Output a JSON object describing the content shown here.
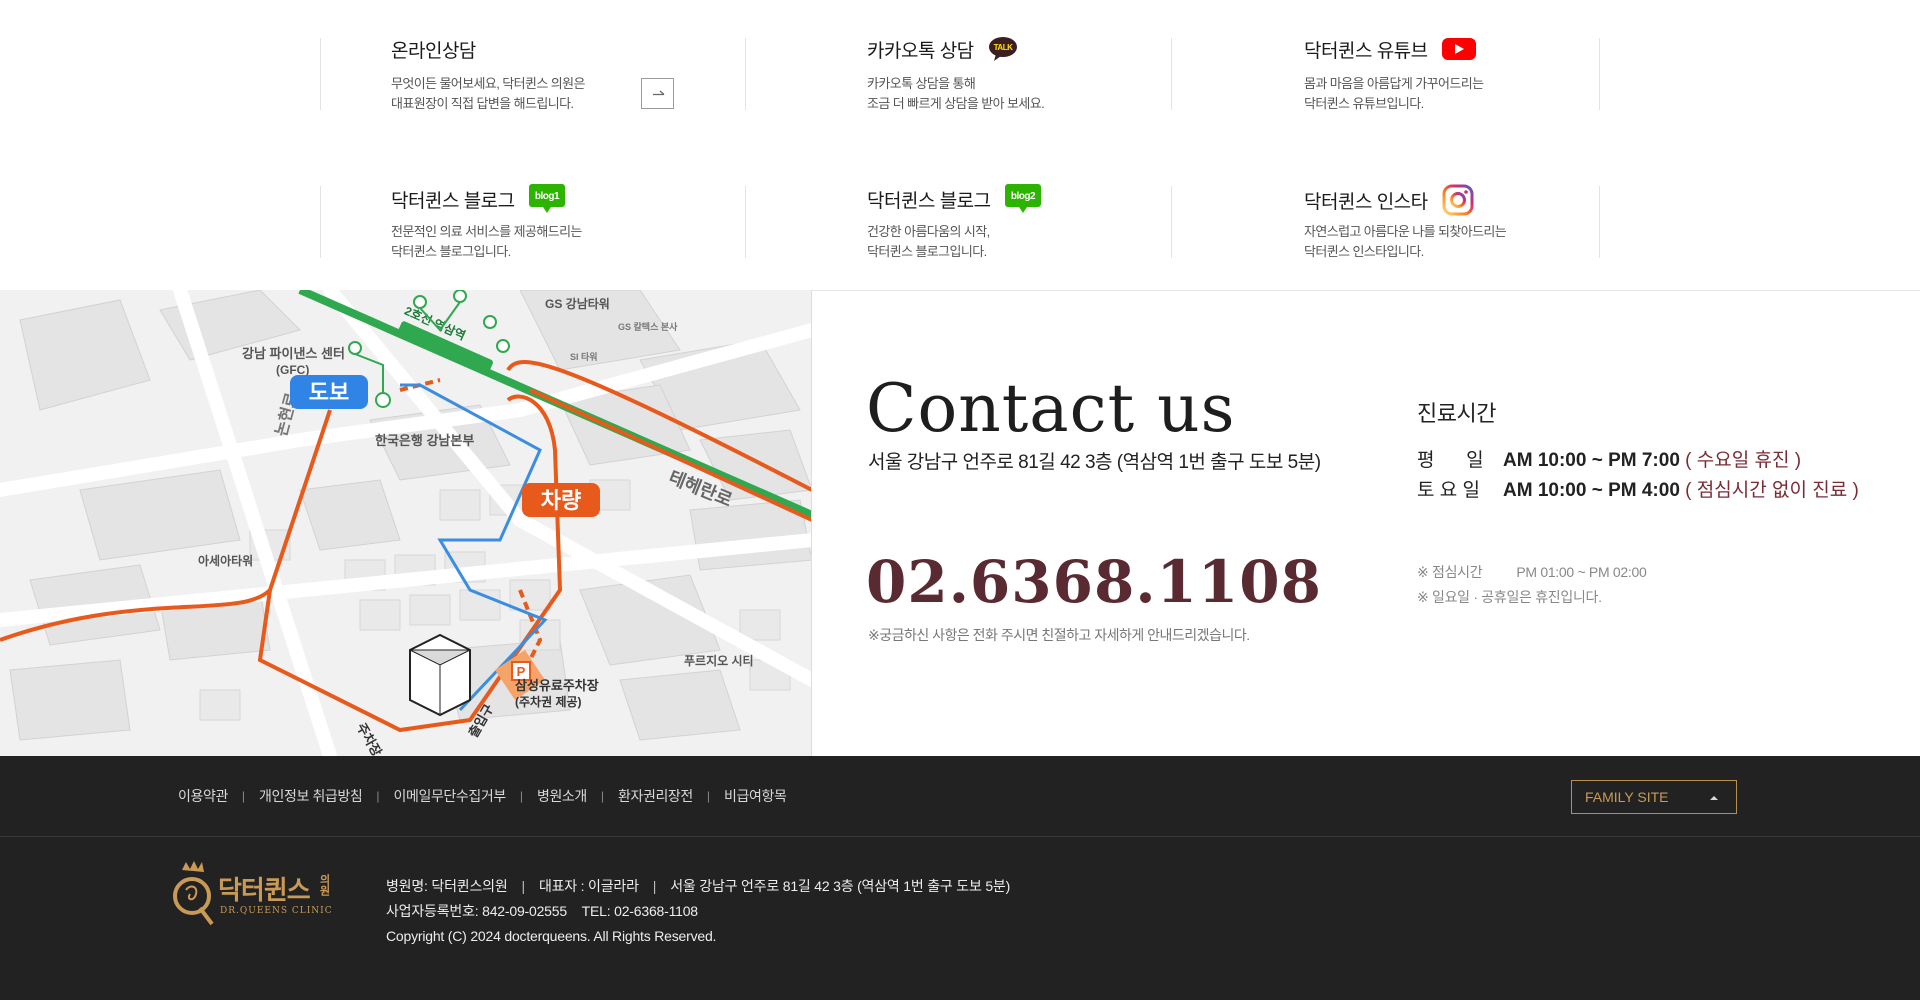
{
  "services": [
    {
      "title": "온라인상담",
      "desc": [
        "무엇이든 물어보세요, 닥터퀸스 의원은",
        "대표원장이 직접 답변을 해드립니다."
      ],
      "badge": "arrow"
    },
    {
      "title": "카카오톡 상담",
      "desc": [
        "카카오톡 상담을 통해",
        "조금 더 빠르게 상담을 받아 보세요."
      ],
      "badge": "kakao",
      "badge_text": "TALK"
    },
    {
      "title": "닥터퀸스 유튜브",
      "desc": [
        "몸과 마음을 아름답게 가꾸어드리는",
        "닥터퀸스 유튜브입니다."
      ],
      "badge": "youtube"
    },
    {
      "title": "닥터퀸스 블로그",
      "desc": [
        "전문적인 의료 서비스를 제공해드리는",
        "닥터퀸스 블로그입니다."
      ],
      "badge": "blog",
      "badge_text": "blog1"
    },
    {
      "title": "닥터퀸스 블로그",
      "desc": [
        "건강한 아름다움의 시작,",
        "닥터퀸스 블로그입니다."
      ],
      "badge": "blog",
      "badge_text": "blog2"
    },
    {
      "title": "닥터퀸스 인스타",
      "desc": [
        "자연스럽고 아름다운 나를 되찾아드리는",
        "닥터퀸스 인스타입니다."
      ],
      "badge": "instagram"
    }
  ],
  "map": {
    "walk_label": "도보",
    "car_label": "차량",
    "labels": {
      "gfc": "강남 파이낸스 센터",
      "gfc_sub": "(GFC)",
      "gs_tower": "GS 강남타워",
      "gs_hq": "GS 칼텍스 본사",
      "si_tower": "SI 타워",
      "bok": "한국은행 강남본부",
      "line2": "2호선 역삼역",
      "teheran": "테헤란로",
      "asea": "아세아타워",
      "pureujio": "푸르지오 시티",
      "parking": "삼성유료주차장",
      "parking_sub": "(주차권 제공)",
      "exit_main": "출입구",
      "exit_park": "주차장 진입로",
      "road_left": "논현로"
    }
  },
  "contact": {
    "title": "Contact us",
    "address": "서울 강남구 언주로 81길 42 3층 (역삼역 1번 출구 도보 5분)",
    "phone": "02.6368.1108",
    "phone_note": "※궁금하신 사항은 전화 주시면 친절하고 자세하게 안내드리겠습니다."
  },
  "hours": {
    "title": "진료시간",
    "rows": [
      {
        "day": "평      일",
        "time": "AM 10:00 ~ PM 7:00",
        "note": "( 수요일 휴진 )"
      },
      {
        "day": "토 요 일",
        "time": "AM 10:00 ~ PM 4:00",
        "note": "( 점심시간 없이 진료 )"
      }
    ],
    "lunch_label": "※ 점심시간",
    "lunch_time": "PM 01:00 ~ PM 02:00",
    "holiday_note": "※ 일요일 · 공휴일은 휴진입니다."
  },
  "footer": {
    "links": [
      "이용약관",
      "개인정보 취급방침",
      "이메일무단수집거부",
      "병원소개",
      "환자권리장전",
      "비급여항목"
    ],
    "family_site": "FAMILY SITE",
    "logo_text": "닥터퀸스",
    "logo_small": "의원",
    "logo_sub": "DR.QUEENS CLINIC",
    "info_line1": {
      "name": "병원명: 닥터퀸스의원",
      "rep": "대표자 : 이글라라",
      "address": "서울 강남구 언주로 81길 42 3층 (역삼역 1번 출구 도보 5분)"
    },
    "info_line2": "사업자등록번호: 842-09-02555    TEL: 02-6368-1108",
    "copyright": "Copyright (C) 2024 docterqueens. All Rights Reserved."
  },
  "colors": {
    "phone": "#5a2a32",
    "hours_note": "#7a2b35",
    "footer_bg": "#222222",
    "gold": "#c99a55",
    "route_walk": "#3b8de0",
    "route_car": "#e8591c",
    "subway_green": "#2fa84f"
  }
}
